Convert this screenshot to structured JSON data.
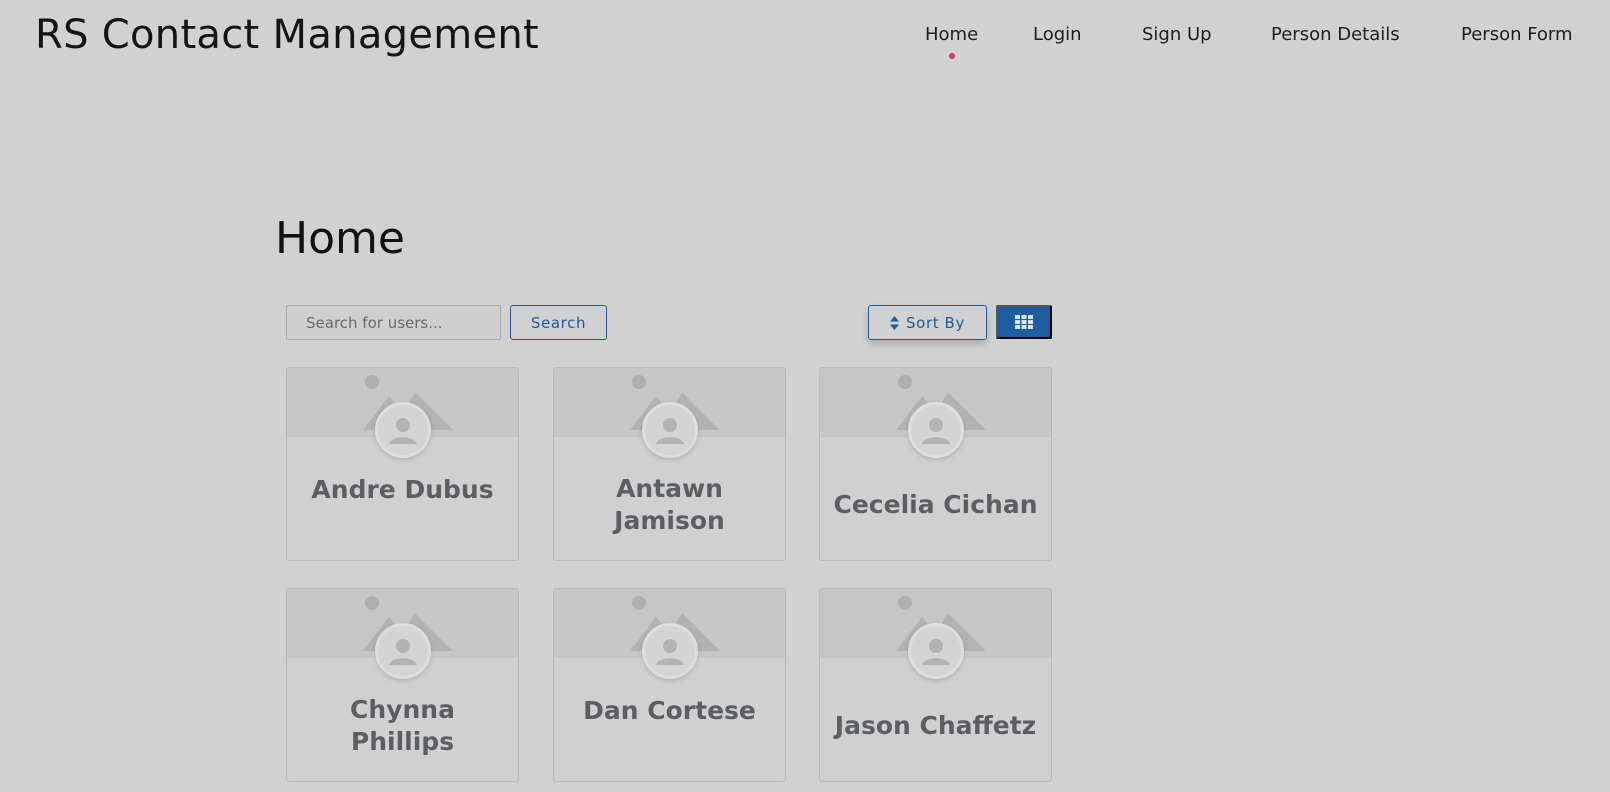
{
  "app": {
    "title": "RS Contact Management"
  },
  "nav": {
    "items": [
      {
        "label": "Home",
        "active": true
      },
      {
        "label": "Login",
        "active": false
      },
      {
        "label": "Sign Up",
        "active": false
      },
      {
        "label": "Person Details",
        "active": false
      },
      {
        "label": "Person Form",
        "active": false
      }
    ]
  },
  "page": {
    "title": "Home"
  },
  "toolbar": {
    "search_placeholder": "Search for users...",
    "search_value": "",
    "search_label": "Search",
    "sort_label": "Sort By",
    "sort_icon": "sort-icon",
    "view_icon": "grid-view-icon"
  },
  "contacts": [
    {
      "name": "Andre Dubus"
    },
    {
      "name": "Antawn Jamison"
    },
    {
      "name": "Cecelia Cichan"
    },
    {
      "name": "Chynna Phillips"
    },
    {
      "name": "Dan Cortese"
    },
    {
      "name": "Jason Chaffetz"
    }
  ],
  "colors": {
    "background": "#d1d1d1",
    "accent": "#1e5fa3",
    "active_dot": "#d63c6a",
    "card_name": "#5b5e63"
  }
}
